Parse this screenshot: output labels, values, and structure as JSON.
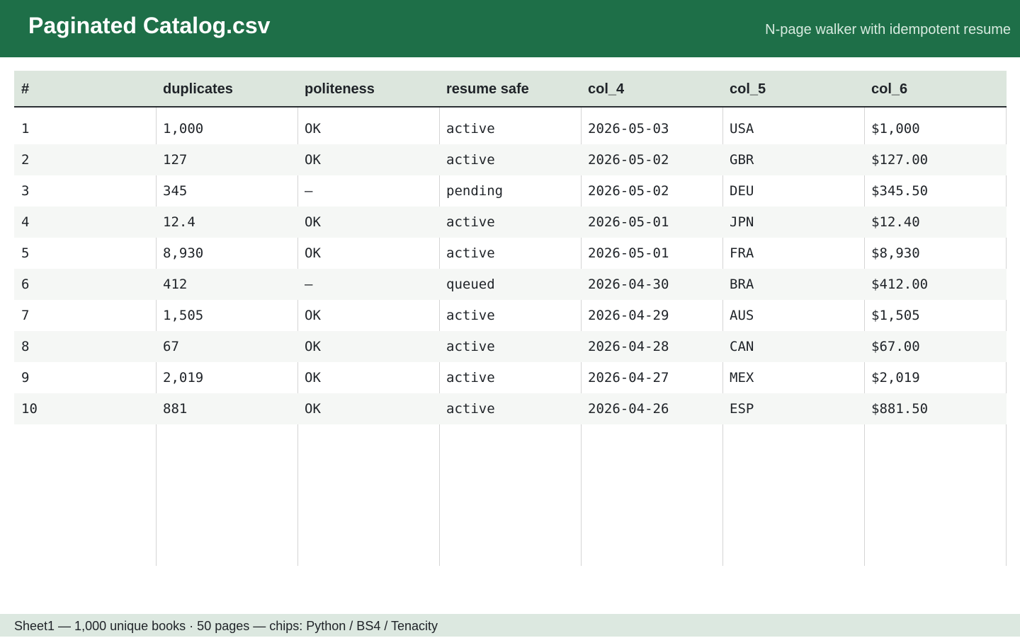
{
  "window": {
    "title": "Paginated Catalog.csv",
    "subtitle": "N-page walker with idempotent resume"
  },
  "table": {
    "columns": [
      "#",
      "duplicates",
      "politeness",
      "resume safe",
      "col_4",
      "col_5",
      "col_6"
    ],
    "rows": [
      [
        "1",
        "1,000",
        "OK",
        "active",
        "2026-05-03",
        "USA",
        "$1,000"
      ],
      [
        "2",
        "127",
        "OK",
        "active",
        "2026-05-02",
        "GBR",
        "$127.00"
      ],
      [
        "3",
        "345",
        "—",
        "pending",
        "2026-05-02",
        "DEU",
        "$345.50"
      ],
      [
        "4",
        "12.4",
        "OK",
        "active",
        "2026-05-01",
        "JPN",
        "$12.40"
      ],
      [
        "5",
        "8,930",
        "OK",
        "active",
        "2026-05-01",
        "FRA",
        "$8,930"
      ],
      [
        "6",
        "412",
        "—",
        "queued",
        "2026-04-30",
        "BRA",
        "$412.00"
      ],
      [
        "7",
        "1,505",
        "OK",
        "active",
        "2026-04-29",
        "AUS",
        "$1,505"
      ],
      [
        "8",
        "67",
        "OK",
        "active",
        "2026-04-28",
        "CAN",
        "$67.00"
      ],
      [
        "9",
        "2,019",
        "OK",
        "active",
        "2026-04-27",
        "MEX",
        "$2,019"
      ],
      [
        "10",
        "881",
        "OK",
        "active",
        "2026-04-26",
        "ESP",
        "$881.50"
      ]
    ]
  },
  "status_bar": {
    "text": "Sheet1 — 1,000 unique books · 50 pages — chips: Python / BS4 / Tenacity"
  },
  "colors": {
    "title_bar": "#1e6f48",
    "header_bg": "#dce6dd",
    "status_bar_bg": "#dce8e0",
    "alt_row_bg": "#f5f7f5"
  }
}
